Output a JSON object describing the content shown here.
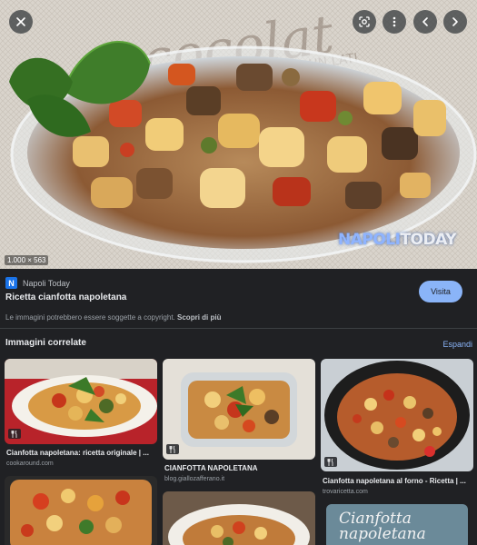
{
  "viewer": {
    "image_dimensions": "1.000 × 563",
    "watermark": {
      "left": "NAPOLI",
      "right": "TODAY"
    }
  },
  "source": {
    "favicon_letter": "N",
    "name": "Napoli Today",
    "title": "Ricetta cianfotta napoletana",
    "visit_label": "Visita"
  },
  "copyright": {
    "text": "Le immagini potrebbero essere soggette a copyright.",
    "link": "Scopri di più"
  },
  "related": {
    "title": "Immagini correlate",
    "expand_label": "Espandi",
    "items": [
      {
        "title": "Cianfotta napoletana: ricetta originale | ...",
        "site": "cookaround.com"
      },
      {
        "title": "CIANFOTTA NAPOLETANA",
        "site": "blog.giallozafferano.it"
      },
      {
        "title": "Cianfotta napoletana al forno - Ricetta | ...",
        "site": "trovaricetta.com"
      },
      {
        "overlay_text": "Cianfotta napoletana"
      }
    ]
  },
  "colors": {
    "background": "#202124",
    "accent": "#8ab4f8",
    "favicon": "#1a73e8"
  }
}
